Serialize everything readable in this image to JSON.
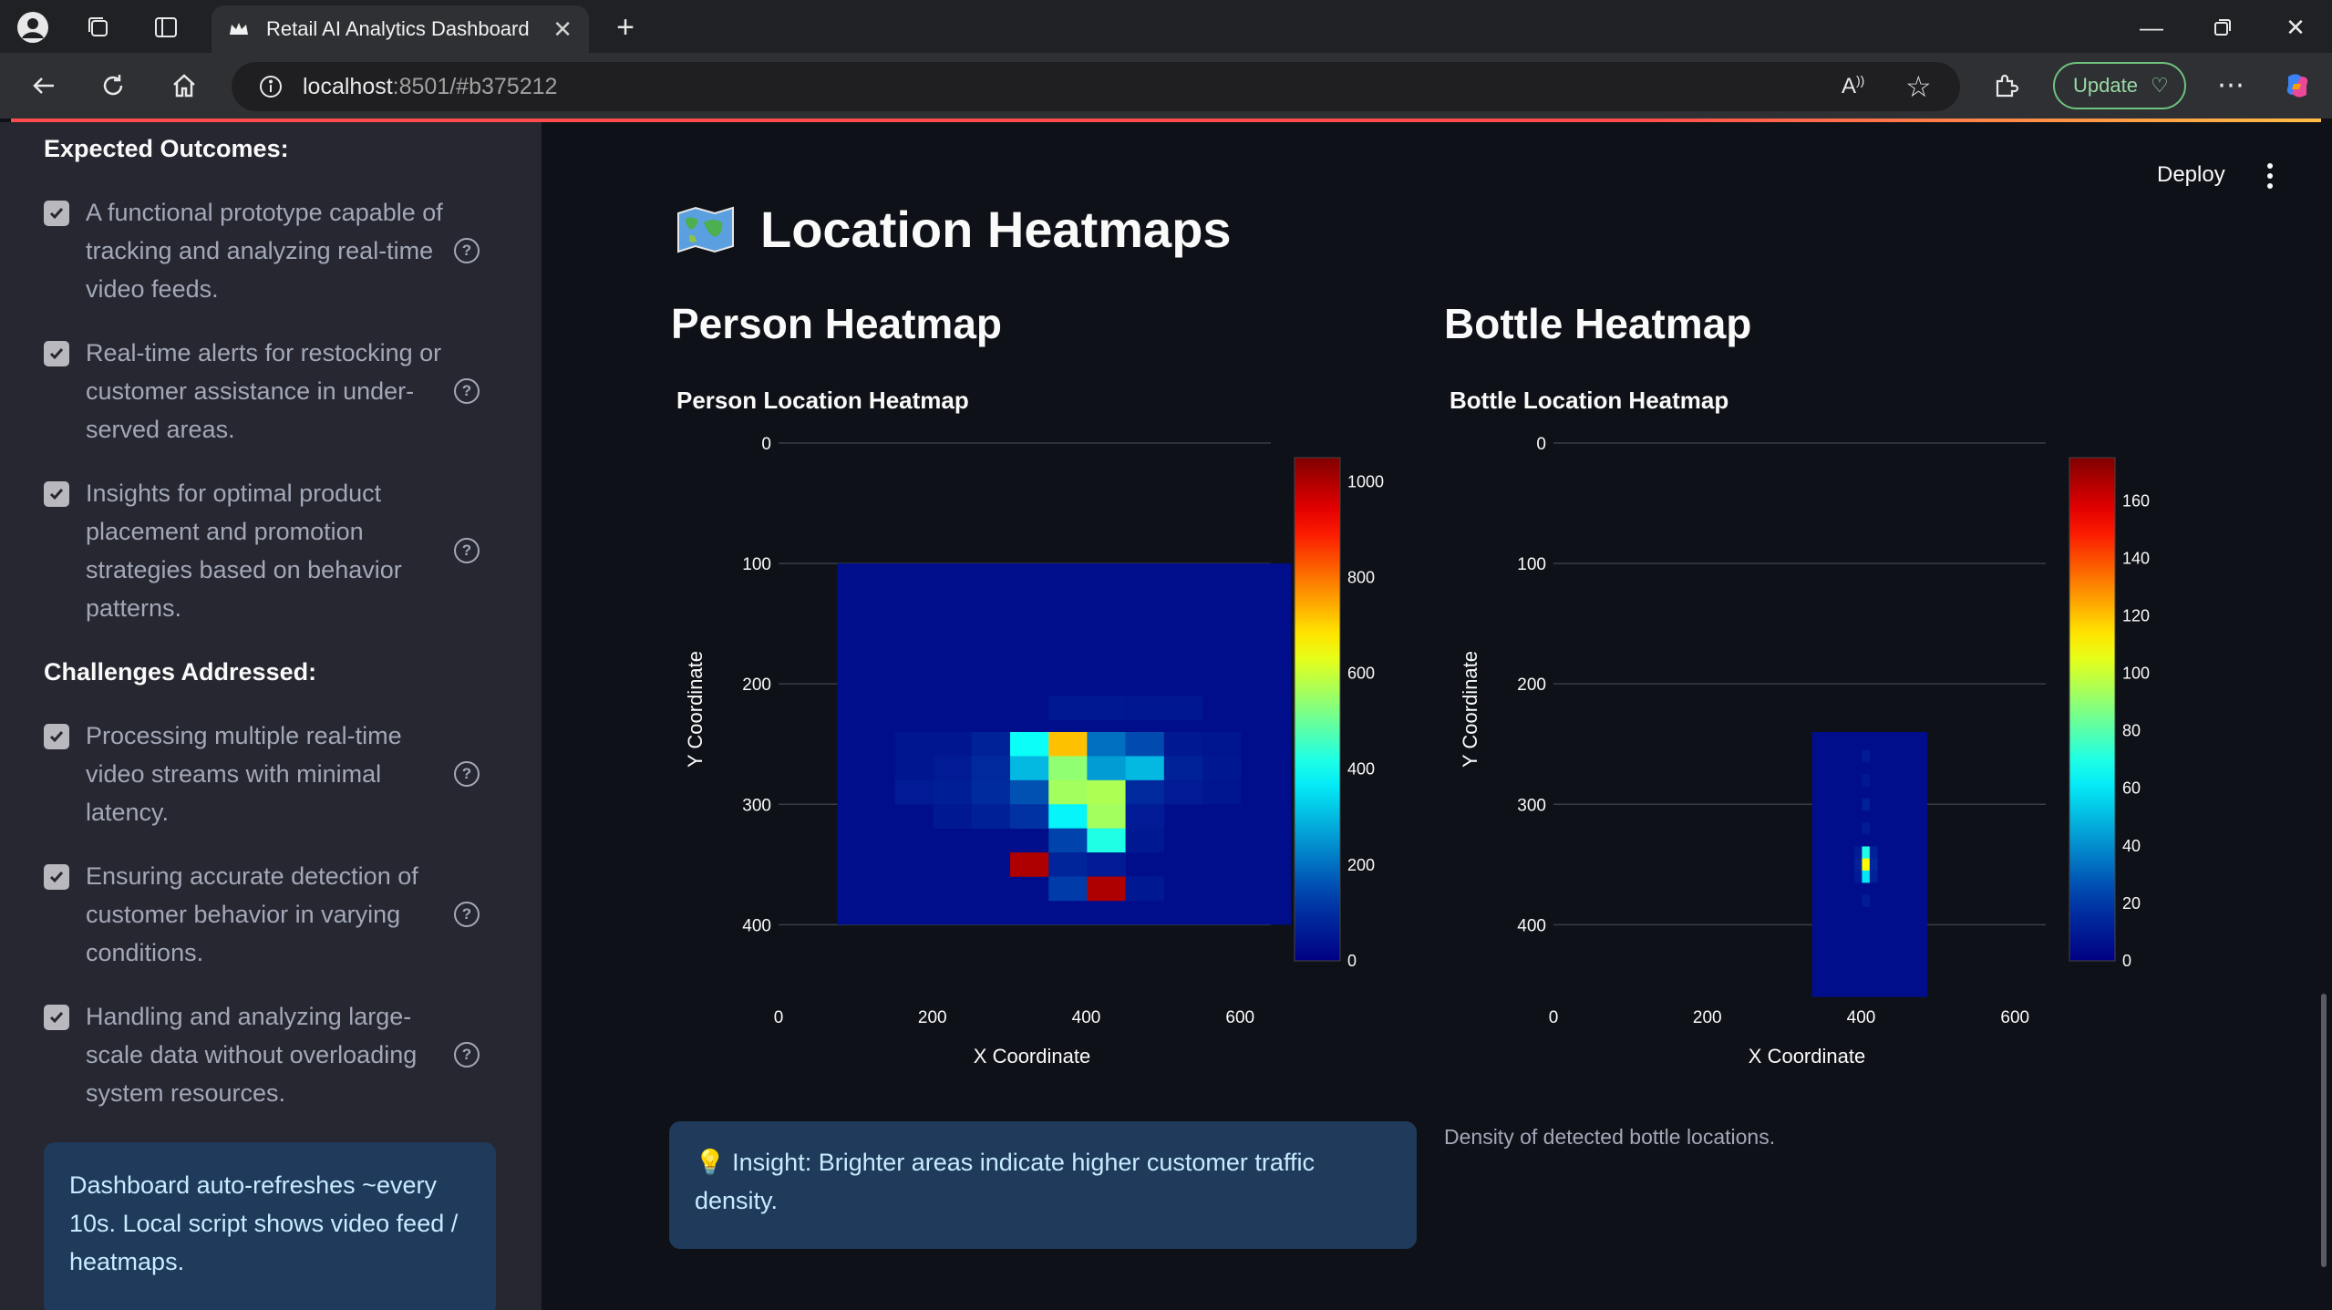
{
  "browser": {
    "tab_title": "Retail AI Analytics Dashboard",
    "url_host": "localhost",
    "url_rest": ":8501/#b375212",
    "update_label": "Update"
  },
  "sidebar": {
    "outcomes_heading": "Expected Outcomes:",
    "outcomes": [
      {
        "lines": [
          "A functional prototype capable of",
          "tracking and analyzing real-time",
          "video feeds."
        ],
        "checked": true
      },
      {
        "lines": [
          "Real-time alerts for restocking or",
          "customer assistance in under-",
          "served areas."
        ],
        "checked": true
      },
      {
        "lines": [
          "Insights for optimal product",
          "placement and promotion",
          "strategies based on behavior",
          "patterns."
        ],
        "checked": true
      }
    ],
    "challenges_heading": "Challenges Addressed:",
    "challenges": [
      {
        "lines": [
          "Processing multiple real-time",
          "video streams with minimal",
          "latency."
        ],
        "checked": true
      },
      {
        "lines": [
          "Ensuring accurate detection of",
          "customer behavior in varying",
          "conditions."
        ],
        "checked": true
      },
      {
        "lines": [
          "Handling and analyzing large-",
          "scale data without overloading",
          "system resources."
        ],
        "checked": true
      }
    ],
    "info_text": "Dashboard auto-refreshes ~every 10s. Local script shows video feed / heatmaps."
  },
  "header": {
    "deploy_label": "Deploy"
  },
  "main": {
    "title": "Location Heatmaps",
    "person_subtitle": "Person Heatmap",
    "bottle_subtitle": "Bottle Heatmap",
    "insight_icon": "lightbulb-icon",
    "insight_emoji": "💡",
    "insight_text": "Insight: Brighter areas indicate higher customer traffic density.",
    "bottle_caption": "Density of detected bottle locations."
  },
  "colors": {
    "accent": "#ff4b4b",
    "sidebar_bg": "#262730",
    "main_bg": "#0e1117",
    "info_bg": "#1f3a5a",
    "info_text": "#c7ebff"
  },
  "chart_data": [
    {
      "type": "heatmap",
      "title": "Person Location Heatmap",
      "xlabel": "X Coordinate",
      "ylabel": "Y Coordinate",
      "xlim": [
        0,
        640
      ],
      "ylim": [
        0,
        480
      ],
      "y_reversed": true,
      "xticks": [
        0,
        200,
        400,
        600
      ],
      "yticks": [
        0,
        100,
        200,
        300,
        400
      ],
      "colorscale": "Jet",
      "colorbar_range": [
        0,
        1050
      ],
      "colorbar_ticks": [
        0,
        200,
        400,
        600,
        800,
        1000
      ],
      "grid": true,
      "x_extent": [
        50,
        640
      ],
      "y_extent": [
        100,
        400
      ],
      "cell_size": 50,
      "base_value": 30,
      "cells": [
        {
          "x": 350,
          "y": 220,
          "v": 55
        },
        {
          "x": 400,
          "y": 220,
          "v": 55
        },
        {
          "x": 450,
          "y": 220,
          "v": 50
        },
        {
          "x": 500,
          "y": 220,
          "v": 50
        },
        {
          "x": 150,
          "y": 250,
          "v": 45
        },
        {
          "x": 200,
          "y": 250,
          "v": 45
        },
        {
          "x": 250,
          "y": 250,
          "v": 75
        },
        {
          "x": 300,
          "y": 250,
          "v": 400
        },
        {
          "x": 350,
          "y": 250,
          "v": 720
        },
        {
          "x": 400,
          "y": 250,
          "v": 200
        },
        {
          "x": 450,
          "y": 250,
          "v": 150
        },
        {
          "x": 500,
          "y": 250,
          "v": 55
        },
        {
          "x": 550,
          "y": 250,
          "v": 45
        },
        {
          "x": 150,
          "y": 270,
          "v": 45
        },
        {
          "x": 200,
          "y": 270,
          "v": 60
        },
        {
          "x": 250,
          "y": 270,
          "v": 90
        },
        {
          "x": 300,
          "y": 270,
          "v": 300
        },
        {
          "x": 350,
          "y": 270,
          "v": 540
        },
        {
          "x": 400,
          "y": 270,
          "v": 260
        },
        {
          "x": 450,
          "y": 270,
          "v": 300
        },
        {
          "x": 500,
          "y": 270,
          "v": 75
        },
        {
          "x": 550,
          "y": 270,
          "v": 50
        },
        {
          "x": 150,
          "y": 290,
          "v": 60
        },
        {
          "x": 200,
          "y": 290,
          "v": 65
        },
        {
          "x": 250,
          "y": 290,
          "v": 95
        },
        {
          "x": 300,
          "y": 290,
          "v": 160
        },
        {
          "x": 350,
          "y": 290,
          "v": 560
        },
        {
          "x": 400,
          "y": 290,
          "v": 570
        },
        {
          "x": 450,
          "y": 290,
          "v": 90
        },
        {
          "x": 500,
          "y": 290,
          "v": 60
        },
        {
          "x": 550,
          "y": 290,
          "v": 45
        },
        {
          "x": 200,
          "y": 310,
          "v": 55
        },
        {
          "x": 250,
          "y": 310,
          "v": 70
        },
        {
          "x": 300,
          "y": 310,
          "v": 110
        },
        {
          "x": 350,
          "y": 310,
          "v": 380
        },
        {
          "x": 400,
          "y": 310,
          "v": 560
        },
        {
          "x": 450,
          "y": 310,
          "v": 60
        },
        {
          "x": 350,
          "y": 330,
          "v": 140
        },
        {
          "x": 400,
          "y": 330,
          "v": 420
        },
        {
          "x": 450,
          "y": 330,
          "v": 55
        },
        {
          "x": 300,
          "y": 350,
          "v": 1000
        },
        {
          "x": 350,
          "y": 350,
          "v": 80
        },
        {
          "x": 400,
          "y": 350,
          "v": 60
        },
        {
          "x": 350,
          "y": 370,
          "v": 130
        },
        {
          "x": 400,
          "y": 370,
          "v": 1000
        },
        {
          "x": 450,
          "y": 370,
          "v": 55
        }
      ]
    },
    {
      "type": "heatmap",
      "title": "Bottle Location Heatmap",
      "xlabel": "X Coordinate",
      "ylabel": "Y Coordinate",
      "xlim": [
        0,
        640
      ],
      "ylim": [
        0,
        480
      ],
      "y_reversed": true,
      "xticks": [
        0,
        200,
        400,
        600
      ],
      "yticks": [
        0,
        100,
        200,
        300,
        400
      ],
      "colorscale": "Jet",
      "colorbar_range": [
        0,
        175
      ],
      "colorbar_ticks": [
        0,
        20,
        40,
        60,
        80,
        100,
        120,
        140,
        160
      ],
      "grid": true,
      "x_extent": [
        310,
        460
      ],
      "y_extent": [
        240,
        460
      ],
      "cell_size": 10,
      "base_value": 5,
      "cells": [
        {
          "x": 380,
          "y": 260,
          "v": 10
        },
        {
          "x": 380,
          "y": 280,
          "v": 9
        },
        {
          "x": 380,
          "y": 300,
          "v": 12
        },
        {
          "x": 380,
          "y": 320,
          "v": 10
        },
        {
          "x": 370,
          "y": 340,
          "v": 10
        },
        {
          "x": 380,
          "y": 340,
          "v": 70
        },
        {
          "x": 390,
          "y": 340,
          "v": 12
        },
        {
          "x": 370,
          "y": 350,
          "v": 12
        },
        {
          "x": 380,
          "y": 350,
          "v": 110
        },
        {
          "x": 390,
          "y": 350,
          "v": 15
        },
        {
          "x": 370,
          "y": 360,
          "v": 10
        },
        {
          "x": 380,
          "y": 360,
          "v": 60
        },
        {
          "x": 390,
          "y": 360,
          "v": 12
        },
        {
          "x": 380,
          "y": 380,
          "v": 10
        }
      ]
    }
  ]
}
